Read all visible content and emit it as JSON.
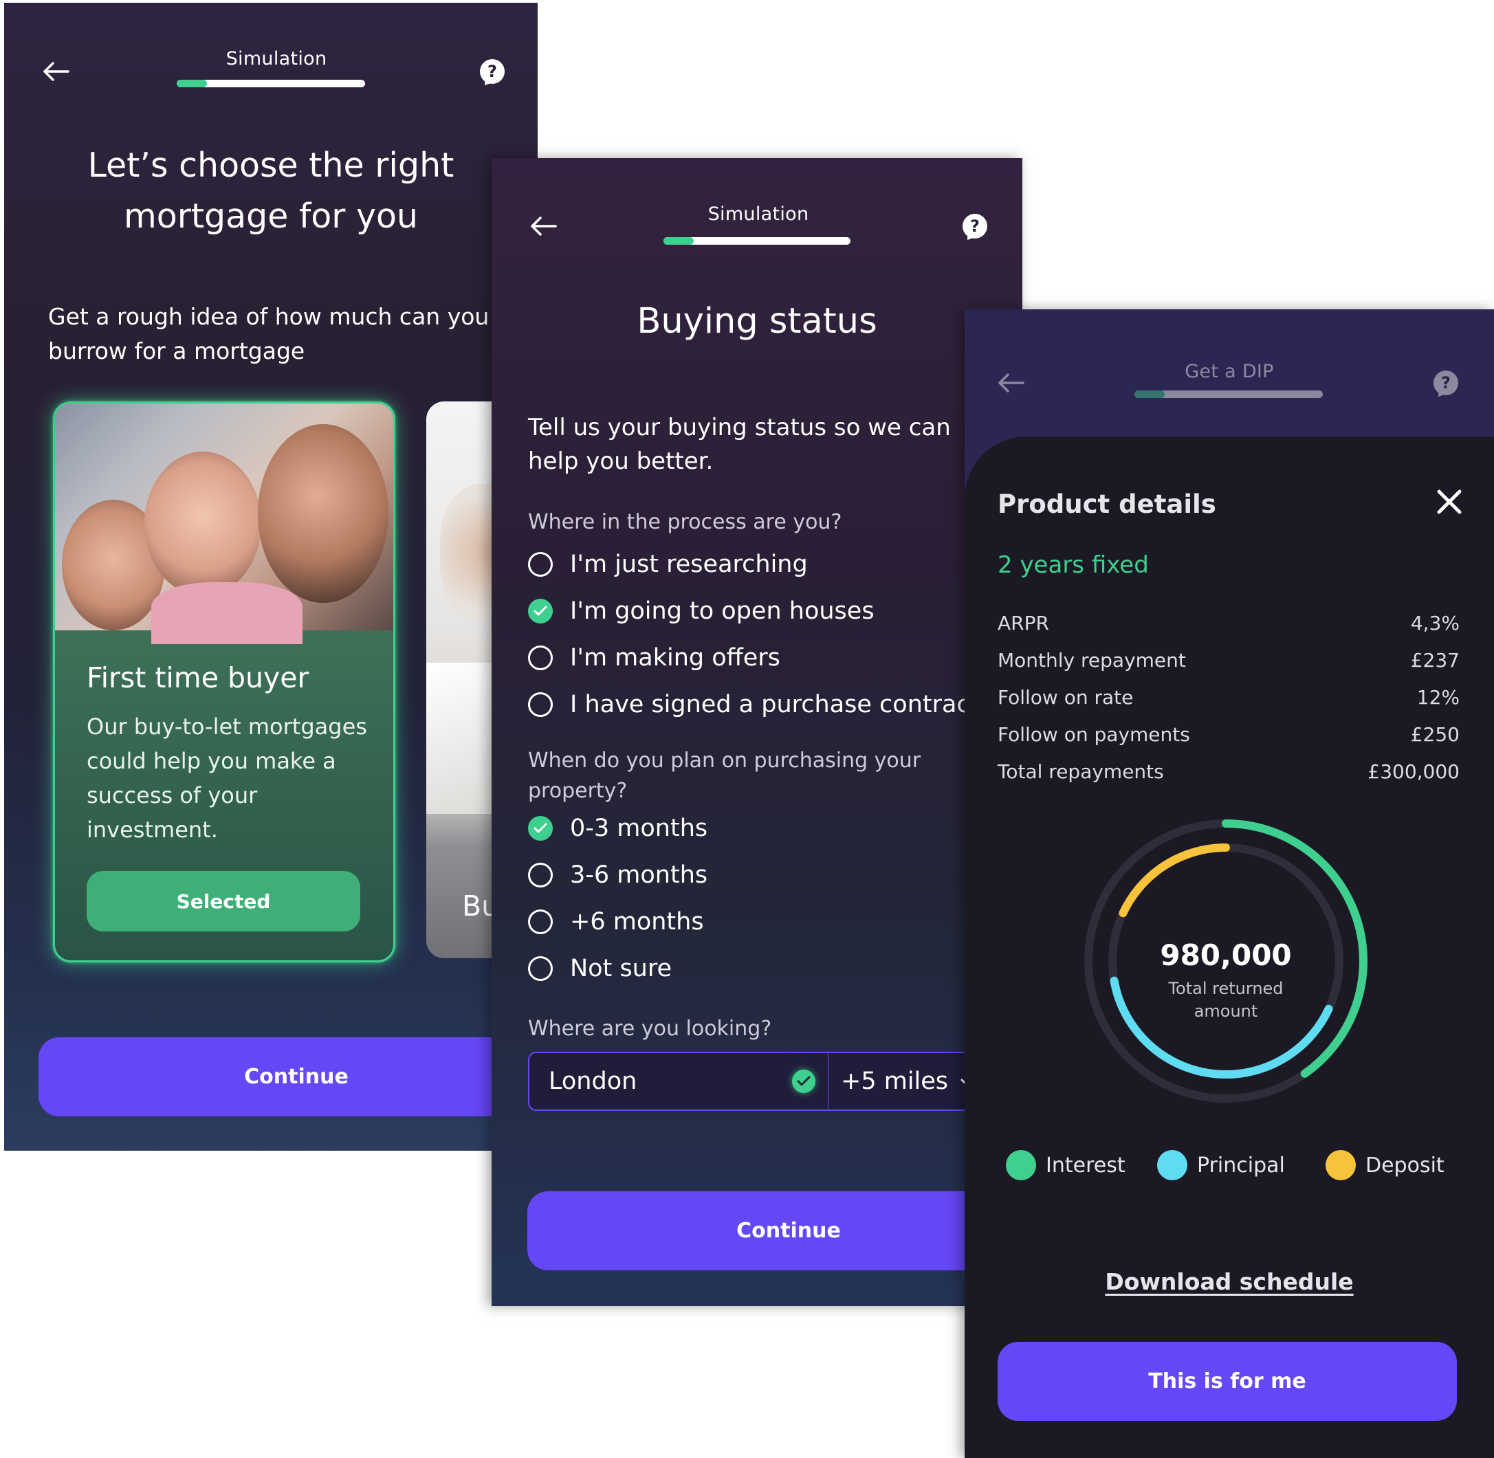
{
  "colors": {
    "accent": "#6647f6",
    "green": "#3fd08f",
    "cyan": "#5fdcf2",
    "yellow": "#f7c33a"
  },
  "screen1": {
    "header": {
      "title": "Simulation",
      "progress": 0.16
    },
    "title_line1": "Let’s choose the right",
    "title_line2": "mortgage for you",
    "subtitle_line1": "Get a rough idea of how much can you",
    "subtitle_line2": "burrow for a mortgage",
    "card": {
      "title": "First time buyer",
      "text": "Our buy-to-let mortgages could help you make a success of your investment.",
      "button": "Selected"
    },
    "card2_title_partial": "Bu",
    "continue": "Continue"
  },
  "screen2": {
    "header": {
      "title": "Simulation",
      "progress": 0.16
    },
    "title": "Buying status",
    "intro": "Tell us your buying status so we can help you better.",
    "q1": "Where in the process are you?",
    "q1_options": [
      {
        "label": "I'm just researching",
        "checked": false
      },
      {
        "label": "I'm going to open houses",
        "checked": true
      },
      {
        "label": "I'm making offers",
        "checked": false
      },
      {
        "label": "I have signed a purchase contract",
        "checked": false
      }
    ],
    "q2": "When do you plan on purchasing your property?",
    "q2_options": [
      {
        "label": "0-3 months",
        "checked": true
      },
      {
        "label": "3-6 months",
        "checked": false
      },
      {
        "label": "+6 months",
        "checked": false
      },
      {
        "label": "Not sure",
        "checked": false
      }
    ],
    "q3": "Where are you looking?",
    "location": "London",
    "radius": "+5 miles",
    "continue": "Continue"
  },
  "screen3": {
    "header": {
      "title": "Get a DIP",
      "progress": 0.16
    },
    "sheet_title": "Product details",
    "product": "2 years fixed",
    "details": [
      {
        "label": "ARPR",
        "value": "4,3%"
      },
      {
        "label": "Monthly repayment",
        "value": "£237"
      },
      {
        "label": "Follow on rate",
        "value": "12%"
      },
      {
        "label": "Follow on payments",
        "value": "£250"
      },
      {
        "label": "Total repayments",
        "value": "£300,000"
      }
    ],
    "donut_value": "980,000",
    "donut_caption": "Total returned amount",
    "legend": [
      "Interest",
      "Principal",
      "Deposit"
    ],
    "download": "Download schedule",
    "cta": "This is for me"
  }
}
